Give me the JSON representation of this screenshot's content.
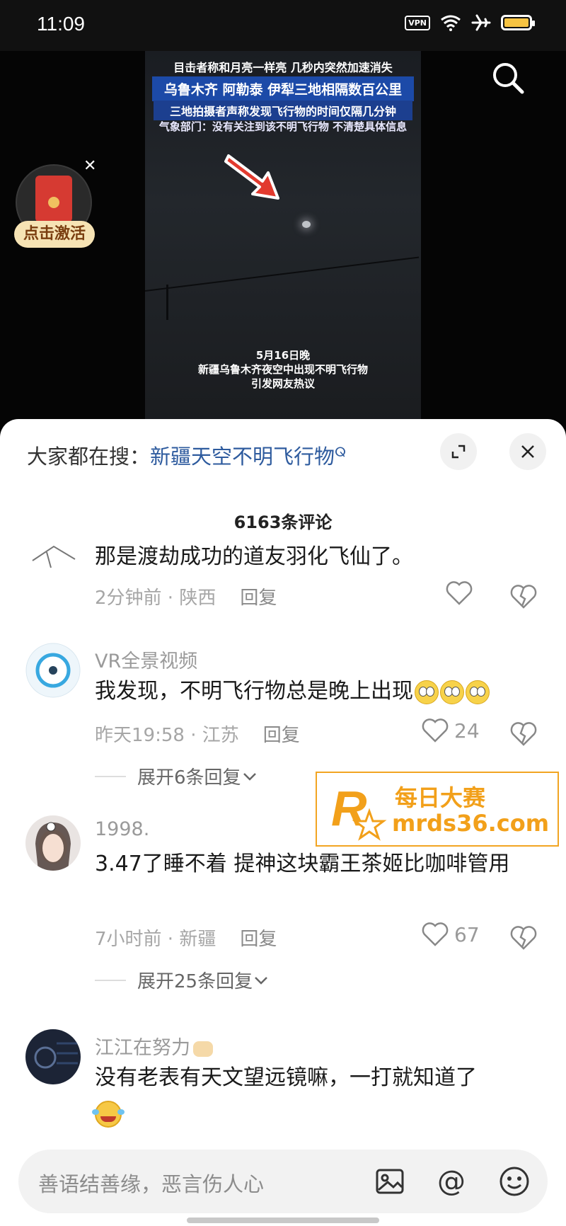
{
  "status_bar": {
    "time": "11:09",
    "vpn": "VPN",
    "icons": [
      "vpn-icon",
      "wifi-icon",
      "airplane-icon",
      "battery-icon"
    ]
  },
  "video": {
    "headline_lines": [
      "目击者称和月亮一样亮 几秒内突然加速消失",
      "乌鲁木齐 阿勒泰 伊犁三地相隔数百公里",
      "三地拍摄者声称发现飞行物的时间仅隔几分钟",
      "气象部门：没有关注到该不明飞行物 不清楚具体信息"
    ],
    "caption_lines": [
      "5月16日晚",
      "新疆乌鲁木齐夜空中出现不明飞行物",
      "引发网友热议"
    ]
  },
  "redpack": {
    "label": "点击激活"
  },
  "sheet": {
    "search_prefix": "大家都在搜：",
    "search_keyword": "新疆天空不明飞行物",
    "comment_count": "6163条评论"
  },
  "comments": [
    {
      "user": "",
      "text": "那是渡劫成功的道友羽化飞仙了。",
      "time": "2分钟前 · 陕西",
      "reply": "回复",
      "likes": ""
    },
    {
      "user": "VR全景视频",
      "text": "我发现，不明飞行物总是晚上出现",
      "time": "昨天19:58 · 江苏",
      "reply": "回复",
      "likes": "24",
      "expand": "展开6条回复"
    },
    {
      "user": "1998.",
      "text": "3.47了睡不着 提神这块霸王茶姬比咖啡管用",
      "time": "7小时前 · 新疆",
      "reply": "回复",
      "likes": "67",
      "expand": "展开25条回复"
    },
    {
      "user": "江江在努力",
      "text": "没有老表有天文望远镜嘛，一打就知道了",
      "time": "",
      "reply": "",
      "likes": ""
    }
  ],
  "watermark": {
    "line1": "每日大赛",
    "line2": "mrds36.com",
    "logo_text": "每日大赛"
  },
  "input": {
    "placeholder": "善语结善缘，恶言伤人心"
  },
  "colors": {
    "sheet_bg": "#ffffff",
    "keyword": "#2e5b9e",
    "watermark": "#f2a01a",
    "redpack_tag": "#f6e3b4"
  }
}
